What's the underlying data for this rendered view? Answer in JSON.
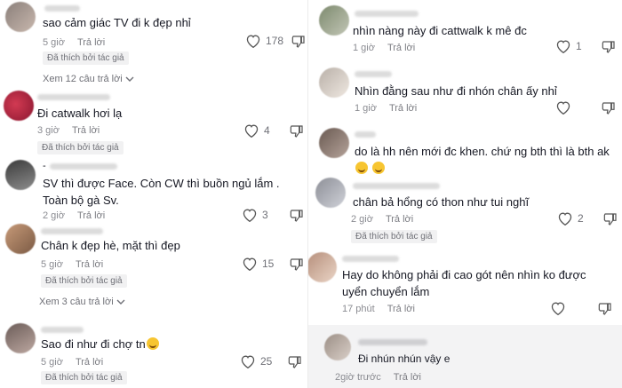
{
  "left_comments": [
    {
      "text": "sao cảm giác TV đi k đẹp nhỉ",
      "time": "5 giờ",
      "reply": "Trả lời",
      "likes": "178",
      "badge": "Đã thích bởi tác giả",
      "more": "Xem 12 câu trả lời"
    },
    {
      "text": "Đi catwalk hơi lạ",
      "time": "3 giờ",
      "reply": "Trả lời",
      "likes": "4",
      "badge": "Đã thích bởi tác giả"
    },
    {
      "prefix": "-",
      "line1": "SV thì được Face. Còn CW thì buồn ngủ lắm .",
      "line2": "Toàn bộ gà Sv.",
      "time": "2 giờ",
      "reply": "Trả lời",
      "likes": "3"
    },
    {
      "text": "Chân k đẹp hè, mặt thì đẹp",
      "time": "5 giờ",
      "reply": "Trả lời",
      "likes": "15",
      "badge": "Đã thích bởi tác giả",
      "more": "Xem 3 câu trả lời"
    },
    {
      "text": "Sao đi như đi chợ tn",
      "time": "5 giờ",
      "reply": "Trả lời",
      "likes": "25",
      "badge": "Đã thích bởi tác giả"
    }
  ],
  "right_comments": [
    {
      "text": "nhìn nàng này đi cattwalk k mê đc",
      "time": "1 giờ",
      "reply": "Trả lời",
      "likes": "1"
    },
    {
      "text": "Nhìn đằng sau như đi nhón chân ấy nhỉ",
      "time": "1 giờ",
      "reply": "Trả lời",
      "likes": ""
    },
    {
      "line1": "do là hh nên mới đc khen. chứ ng bth thì là bth ak",
      "time": "",
      "reply": "",
      "likes": ""
    },
    {
      "text": "chân bả hổng có thon như tui nghĩ",
      "time": "2 giờ",
      "reply": "Trả lời",
      "likes": "2",
      "badge": "Đã thích bởi tác giả"
    },
    {
      "line1": "Hay do không phải đi cao gót nên nhìn ko được",
      "line2": "uyển chuyển lắm",
      "time": "17 phút",
      "reply": "Trả lời",
      "likes": ""
    },
    {
      "text": "Đi nhún nhún vậy e",
      "time": "2giờ trước",
      "reply": "Trả lời"
    }
  ],
  "colors": {
    "text": "#161823",
    "meta": "#8a8b91",
    "badge_bg": "#f1f1f2",
    "highlight": "#f3f3f4"
  },
  "icons": {
    "like": "heart-outline-icon",
    "dislike": "thumbs-down-icon",
    "expand": "chevron-down-icon"
  }
}
